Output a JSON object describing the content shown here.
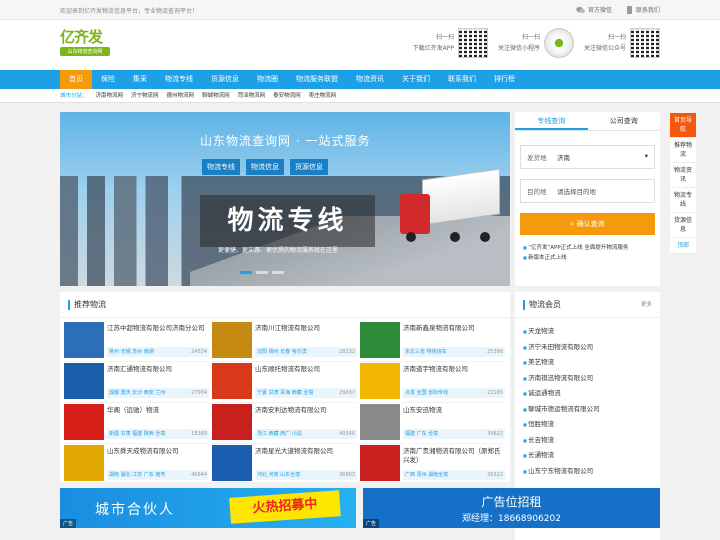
{
  "topbar": {
    "welcome": "欢迎来到亿齐发物流信息平台，专业物流查询平台！",
    "wechat": "官方微信",
    "contact": "联系我们"
  },
  "header": {
    "logo_main": "亿齐发",
    "logo_sub": "山东物流查询网",
    "qr": [
      {
        "line1": "扫一扫",
        "line2": "下载亿齐发APP"
      },
      {
        "line1": "扫一扫",
        "line2": "关注微信小程序"
      },
      {
        "line1": "扫一扫",
        "line2": "关注微信公众号"
      }
    ]
  },
  "nav": [
    "首页",
    "保险",
    "集采",
    "物流专线",
    "货源信息",
    "物流圈",
    "物流服务联盟",
    "物流资讯",
    "关于我们",
    "联系我们",
    "排行榜"
  ],
  "subnav": {
    "label": "城市分站：",
    "cities": [
      "济南物流网",
      "济宁物流网",
      "德州物流网",
      "聊城物流网",
      "菏泽物流网",
      "泰安物流网",
      "枣庄物流网"
    ]
  },
  "banner": {
    "title": "山东物流查询网 · 一站式服务",
    "buttons": [
      "物流专线",
      "物流信息",
      "货源信息"
    ],
    "big": "物流专线",
    "slogan": "更便捷、更实惠、更优质的物流服务就在这里"
  },
  "search": {
    "tabs": [
      "专线查询",
      "公司查询"
    ],
    "from_label": "发货地",
    "from_value": "济南",
    "to_label": "目的地",
    "to_placeholder": "请选择目的地",
    "button": "确认查询",
    "news": [
      "“亿齐发”APP正式上线 全面提升物流服务",
      "新版本正式上线"
    ]
  },
  "sidefix": [
    "首页导航",
    "推荐物流",
    "物流资讯",
    "物流专线",
    "货源信息",
    "顶部"
  ],
  "recommend": {
    "title": "推荐物流",
    "companies": [
      {
        "name": "江苏中超物流有限公司济南分公司",
        "line": "常州 无锡 苏州 南通",
        "num": "24534",
        "logo": "#2a6fb8"
      },
      {
        "name": "济南川江物流有限公司",
        "line": "沈阳 锦州 长春 哈尔滨",
        "num": "28232",
        "logo": "#c48a12"
      },
      {
        "name": "济南新鑫泉物流有限公司",
        "line": "东北三省 特快班车",
        "num": "25386",
        "logo": "#2e8b3a"
      },
      {
        "name": "济南汇通物流有限公司",
        "line": "成都 重庆 长沙 西安 兰州",
        "num": "27904",
        "logo": "#1a5eaa"
      },
      {
        "name": "山东顺托物流有限公司",
        "line": "宁夏 甘肃 青海 西藏 全境",
        "num": "29037",
        "logo": "#d8391b"
      },
      {
        "name": "济南道宇物流有限公司",
        "line": "点发 全国 省际专线",
        "num": "22185",
        "logo": "#f2b600"
      },
      {
        "name": "华阁（远驰）物流",
        "line": "新疆 甘肃 福建 陕西 全境",
        "num": "18389",
        "logo": "#d8201b"
      },
      {
        "name": "济南安利达物流有限公司",
        "line": "浙江 西藏 西广 川渝",
        "num": "40546",
        "logo": "#c81f1f"
      },
      {
        "name": "山东安迅物流",
        "line": "福建 广东 全境",
        "num": "39822",
        "logo": "#8a8a8a"
      },
      {
        "name": "山东舜天成物流有限公司",
        "line": "湖南 湖北 江苏 广东 南粤",
        "num": "46644",
        "logo": "#e0a800"
      },
      {
        "name": "济南星光大道物流有限公司",
        "line": "河北 河南 山东全境",
        "num": "36803",
        "logo": "#1d5db0"
      },
      {
        "name": "济南广贵湘物流有限公司（原郑氏兴发）",
        "line": "广西 贵州 湖南全境",
        "num": "36322",
        "logo": "#c8201e"
      }
    ]
  },
  "members": {
    "title": "物流会员",
    "more": "更多",
    "list": [
      "天龙物流",
      "济宁禾田物流有限公司",
      "美艺物流",
      "济南祺迅物流有限公司",
      "诚运通物流",
      "聊城市德运物流有限公司",
      "恒胜物流",
      "长吉物流",
      "长通物流",
      "山东宁东物流有限公司"
    ]
  },
  "ads": {
    "ad1_text": "城市合伙人",
    "ad1_ribbon": "火热招募中",
    "ad2_title": "广告位招租",
    "ad2_phone": "郑经理：18668906202",
    "tag": "广告"
  }
}
